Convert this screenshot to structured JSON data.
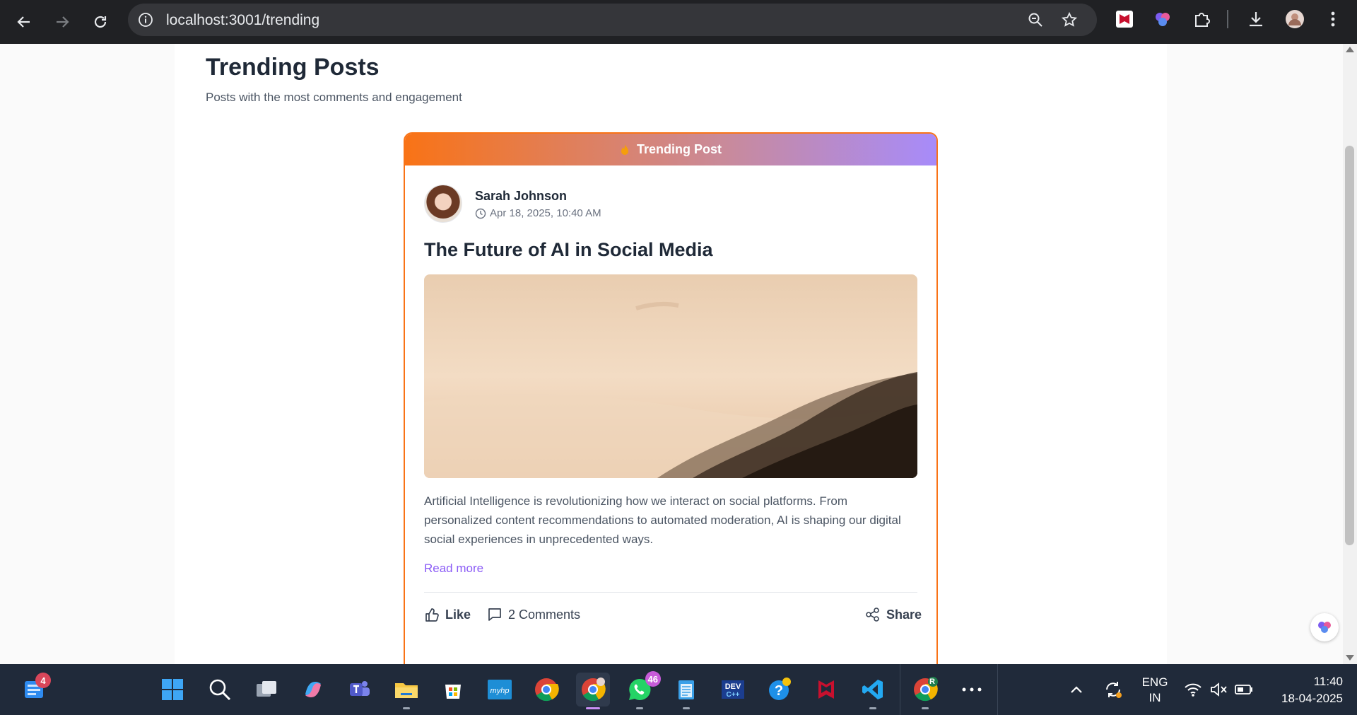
{
  "browser": {
    "url": "localhost:3001/trending",
    "colors": {
      "chrome": "#202124",
      "omnibox": "#35363a"
    }
  },
  "page": {
    "title": "Trending Posts",
    "subtitle": "Posts with the most comments and engagement"
  },
  "post": {
    "banner": "Trending Post",
    "author": "Sarah Johnson",
    "date": "Apr 18, 2025, 10:40 AM",
    "title": "The Future of AI in Social Media",
    "body": "Artificial Intelligence is revolutionizing how we interact on social platforms. From personalized content recommendations to automated moderation, AI is shaping our digital social experiences in unprecedented ways.",
    "read_more": "Read more",
    "actions": {
      "like": "Like",
      "comments": "2 Comments",
      "share": "Share"
    },
    "colors": {
      "border": "#f97316",
      "accent": "#8b5cf6",
      "banner_start": "#f97316",
      "banner_end": "#a78bfa"
    }
  },
  "taskbar": {
    "widgets_badge": "4",
    "whatsapp_badge": "46",
    "chrome_profile_letter": "R",
    "language": "ENG",
    "region": "IN",
    "time": "11:40",
    "date": "18-04-2025"
  }
}
